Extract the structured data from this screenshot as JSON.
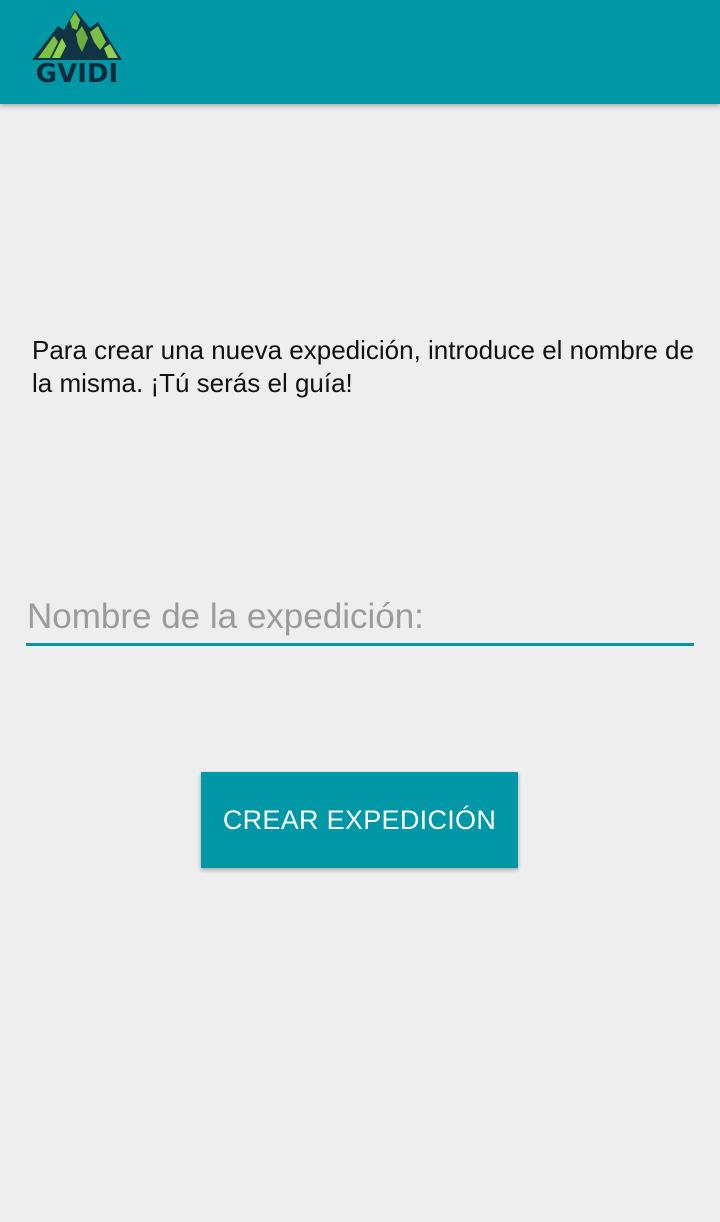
{
  "app_bar": {
    "logo_text": "GVIDI",
    "background_color": "#0097a7",
    "logo_icon": "mountain-logo-icon"
  },
  "main": {
    "description": "Para crear una nueva expedición, introduce el nombre de la misma. ¡Tú serás el guía!",
    "name_field": {
      "value": "",
      "placeholder": "Nombre de la expedición:"
    },
    "create_button_label": "CREAR EXPEDICIÓN"
  },
  "colors": {
    "accent": "#0097a7",
    "background": "#eeeeee",
    "logo_green": "#7cc242",
    "logo_dark": "#0b2a3a"
  }
}
